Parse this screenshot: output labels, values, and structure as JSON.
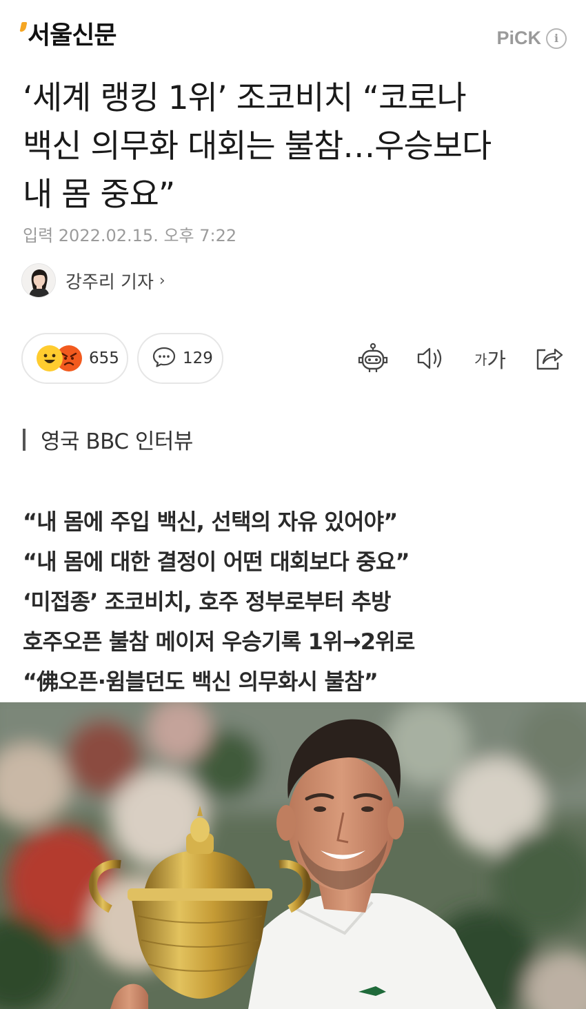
{
  "header": {
    "logo": "서울신문",
    "pick_label": "PiCK",
    "pick_info_icon": "i"
  },
  "article": {
    "title_lines": [
      "‘세계 랭킹 1위’ 조코비치 “코로나",
      "백신 의무화 대회는 불참…우승보다",
      "내 몸 중요”"
    ],
    "date": "입력 2022.02.15. 오후 7:22",
    "author": "강주리 기자",
    "author_chevron": "›",
    "reactions_count": "655",
    "comments_count": "129",
    "font_size_small": "가",
    "font_size_big": "가",
    "subhead": "영국 BBC 인터뷰",
    "summary": [
      "“내 몸에 주입 백신, 선택의 자유 있어야”",
      "“내 몸에 대한 결정이 어떤 대회보다 중요”",
      "‘미접종’ 조코비치, 호주 정부로부터 추방",
      "호주오픈 불참 메이저 우승기록 1위→2위로",
      "“佛오픈·윔블던도 백신 의무화시 불참”"
    ]
  },
  "colors": {
    "logo_accent": "#f5a623",
    "pick_gray": "#9a9a9a",
    "reaction_happy": "#ffcc2f",
    "reaction_angry": "#f25a1e",
    "photo_green": "#3d5c3a",
    "trophy_gold": "#c9a23f"
  },
  "icons": [
    "robot-icon",
    "speaker-icon",
    "font-size-icon",
    "share-icon",
    "comment-icon",
    "happy-emoji-icon",
    "angry-emoji-icon",
    "info-icon"
  ]
}
